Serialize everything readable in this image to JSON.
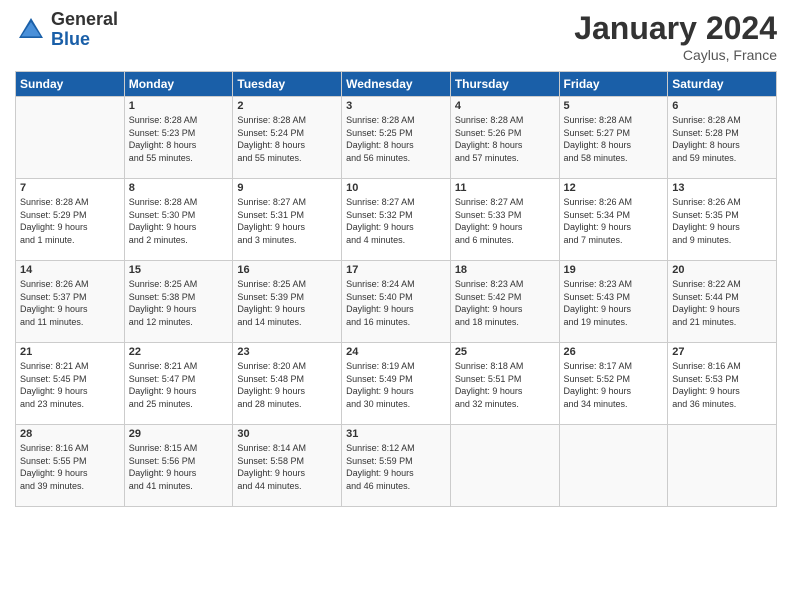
{
  "logo": {
    "general": "General",
    "blue": "Blue"
  },
  "title": "January 2024",
  "location": "Caylus, France",
  "headers": [
    "Sunday",
    "Monday",
    "Tuesday",
    "Wednesday",
    "Thursday",
    "Friday",
    "Saturday"
  ],
  "weeks": [
    [
      {
        "day": "",
        "info": ""
      },
      {
        "day": "1",
        "info": "Sunrise: 8:28 AM\nSunset: 5:23 PM\nDaylight: 8 hours\nand 55 minutes."
      },
      {
        "day": "2",
        "info": "Sunrise: 8:28 AM\nSunset: 5:24 PM\nDaylight: 8 hours\nand 55 minutes."
      },
      {
        "day": "3",
        "info": "Sunrise: 8:28 AM\nSunset: 5:25 PM\nDaylight: 8 hours\nand 56 minutes."
      },
      {
        "day": "4",
        "info": "Sunrise: 8:28 AM\nSunset: 5:26 PM\nDaylight: 8 hours\nand 57 minutes."
      },
      {
        "day": "5",
        "info": "Sunrise: 8:28 AM\nSunset: 5:27 PM\nDaylight: 8 hours\nand 58 minutes."
      },
      {
        "day": "6",
        "info": "Sunrise: 8:28 AM\nSunset: 5:28 PM\nDaylight: 8 hours\nand 59 minutes."
      }
    ],
    [
      {
        "day": "7",
        "info": "Sunrise: 8:28 AM\nSunset: 5:29 PM\nDaylight: 9 hours\nand 1 minute."
      },
      {
        "day": "8",
        "info": "Sunrise: 8:28 AM\nSunset: 5:30 PM\nDaylight: 9 hours\nand 2 minutes."
      },
      {
        "day": "9",
        "info": "Sunrise: 8:27 AM\nSunset: 5:31 PM\nDaylight: 9 hours\nand 3 minutes."
      },
      {
        "day": "10",
        "info": "Sunrise: 8:27 AM\nSunset: 5:32 PM\nDaylight: 9 hours\nand 4 minutes."
      },
      {
        "day": "11",
        "info": "Sunrise: 8:27 AM\nSunset: 5:33 PM\nDaylight: 9 hours\nand 6 minutes."
      },
      {
        "day": "12",
        "info": "Sunrise: 8:26 AM\nSunset: 5:34 PM\nDaylight: 9 hours\nand 7 minutes."
      },
      {
        "day": "13",
        "info": "Sunrise: 8:26 AM\nSunset: 5:35 PM\nDaylight: 9 hours\nand 9 minutes."
      }
    ],
    [
      {
        "day": "14",
        "info": "Sunrise: 8:26 AM\nSunset: 5:37 PM\nDaylight: 9 hours\nand 11 minutes."
      },
      {
        "day": "15",
        "info": "Sunrise: 8:25 AM\nSunset: 5:38 PM\nDaylight: 9 hours\nand 12 minutes."
      },
      {
        "day": "16",
        "info": "Sunrise: 8:25 AM\nSunset: 5:39 PM\nDaylight: 9 hours\nand 14 minutes."
      },
      {
        "day": "17",
        "info": "Sunrise: 8:24 AM\nSunset: 5:40 PM\nDaylight: 9 hours\nand 16 minutes."
      },
      {
        "day": "18",
        "info": "Sunrise: 8:23 AM\nSunset: 5:42 PM\nDaylight: 9 hours\nand 18 minutes."
      },
      {
        "day": "19",
        "info": "Sunrise: 8:23 AM\nSunset: 5:43 PM\nDaylight: 9 hours\nand 19 minutes."
      },
      {
        "day": "20",
        "info": "Sunrise: 8:22 AM\nSunset: 5:44 PM\nDaylight: 9 hours\nand 21 minutes."
      }
    ],
    [
      {
        "day": "21",
        "info": "Sunrise: 8:21 AM\nSunset: 5:45 PM\nDaylight: 9 hours\nand 23 minutes."
      },
      {
        "day": "22",
        "info": "Sunrise: 8:21 AM\nSunset: 5:47 PM\nDaylight: 9 hours\nand 25 minutes."
      },
      {
        "day": "23",
        "info": "Sunrise: 8:20 AM\nSunset: 5:48 PM\nDaylight: 9 hours\nand 28 minutes."
      },
      {
        "day": "24",
        "info": "Sunrise: 8:19 AM\nSunset: 5:49 PM\nDaylight: 9 hours\nand 30 minutes."
      },
      {
        "day": "25",
        "info": "Sunrise: 8:18 AM\nSunset: 5:51 PM\nDaylight: 9 hours\nand 32 minutes."
      },
      {
        "day": "26",
        "info": "Sunrise: 8:17 AM\nSunset: 5:52 PM\nDaylight: 9 hours\nand 34 minutes."
      },
      {
        "day": "27",
        "info": "Sunrise: 8:16 AM\nSunset: 5:53 PM\nDaylight: 9 hours\nand 36 minutes."
      }
    ],
    [
      {
        "day": "28",
        "info": "Sunrise: 8:16 AM\nSunset: 5:55 PM\nDaylight: 9 hours\nand 39 minutes."
      },
      {
        "day": "29",
        "info": "Sunrise: 8:15 AM\nSunset: 5:56 PM\nDaylight: 9 hours\nand 41 minutes."
      },
      {
        "day": "30",
        "info": "Sunrise: 8:14 AM\nSunset: 5:58 PM\nDaylight: 9 hours\nand 44 minutes."
      },
      {
        "day": "31",
        "info": "Sunrise: 8:12 AM\nSunset: 5:59 PM\nDaylight: 9 hours\nand 46 minutes."
      },
      {
        "day": "",
        "info": ""
      },
      {
        "day": "",
        "info": ""
      },
      {
        "day": "",
        "info": ""
      }
    ]
  ]
}
